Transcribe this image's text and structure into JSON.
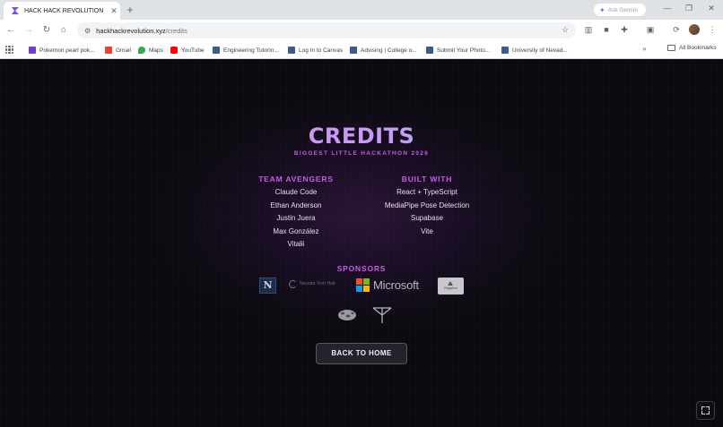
{
  "browser": {
    "tab_title": "HACK HACK REVOLUTION",
    "tab_close": "✕",
    "new_tab": "+",
    "gemini_label": "Ask Gemini",
    "url_host": "hackhackrevolution.xyz",
    "url_path": "/credits",
    "window_controls": {
      "minimize": "—",
      "maximize": "❐",
      "close": "✕"
    },
    "nav": {
      "back": "←",
      "forward": "→",
      "reload": "↻",
      "home": "⌂"
    },
    "accent_color": "#7b4ef0"
  },
  "bookmarks": {
    "items": [
      {
        "label": "Pokemon pearl pok...",
        "icon": "pokemon-favicon",
        "color": "#6b3fd0"
      },
      {
        "label": "Gmail",
        "icon": "gmail-icon",
        "color": "#ea4335"
      },
      {
        "label": "Maps",
        "icon": "maps-icon",
        "color": "#34a853"
      },
      {
        "label": "YouTube",
        "icon": "youtube-icon",
        "color": "#ff0000"
      },
      {
        "label": "Engineering Tutorin...",
        "icon": "page-favicon",
        "color": "#3c5a8a"
      },
      {
        "label": "Log In to Canvas",
        "icon": "page-favicon",
        "color": "#3c5a8a"
      },
      {
        "label": "Advising | College o...",
        "icon": "page-favicon",
        "color": "#3c5a8a"
      },
      {
        "label": "Submit Your Photo...",
        "icon": "page-favicon",
        "color": "#3c5a8a"
      },
      {
        "label": "University of Nevad...",
        "icon": "page-favicon",
        "color": "#3c5a8a"
      }
    ],
    "overflow": "»",
    "all_bookmarks": "All Bookmarks"
  },
  "page": {
    "title": "CREDITS",
    "subtitle": "BIGGEST LITTLE HACKATHON 2026",
    "team": {
      "heading": "TEAM AVENGERS",
      "members": [
        "Claude Code",
        "Ethan Anderson",
        "Justin Juera",
        "Max González",
        "Vitalii"
      ]
    },
    "built_with": {
      "heading": "BUILT WITH",
      "items": [
        "React + TypeScript",
        "MediaPipe Pose Detection",
        "Supabase",
        "Vite"
      ]
    },
    "sponsors": {
      "heading": "SPONSORS",
      "logos": {
        "n_letter": "N",
        "tech_text": "Nevada Tech Hub",
        "microsoft": "Microsoft",
        "ridge": "Ridgeline"
      }
    },
    "back_button": "BACK TO HOME"
  }
}
